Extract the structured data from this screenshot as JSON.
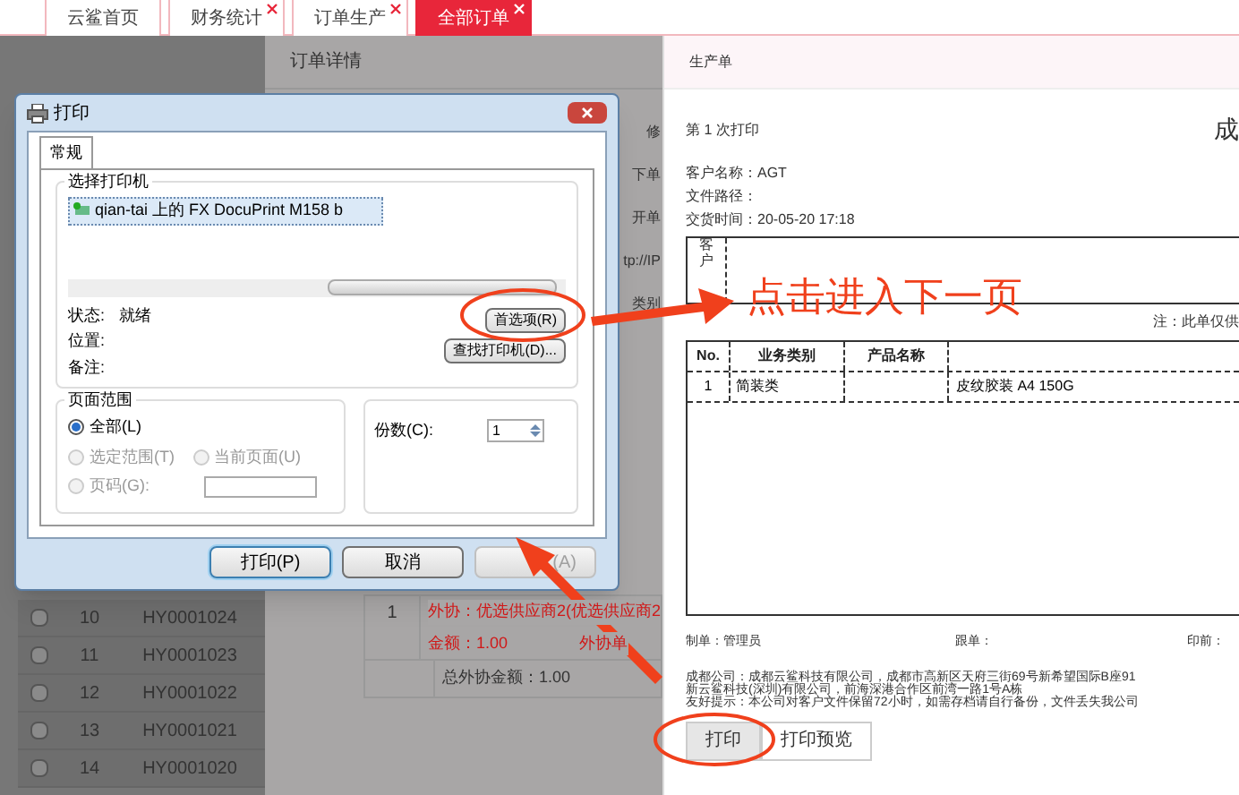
{
  "tabs": [
    {
      "label": "云鲨首页",
      "selected": false,
      "closable": false
    },
    {
      "label": "财务统计",
      "selected": false,
      "closable": true
    },
    {
      "label": "订单生产",
      "selected": false,
      "closable": true
    },
    {
      "label": "全部订单",
      "selected": true,
      "closable": true
    }
  ],
  "order_rows": [
    {
      "checked": false,
      "no": "10",
      "code": "HY0001024"
    },
    {
      "checked": false,
      "no": "11",
      "code": "HY0001023"
    },
    {
      "checked": false,
      "no": "12",
      "code": "HY0001022"
    },
    {
      "checked": false,
      "no": "13",
      "code": "HY0001021"
    },
    {
      "checked": false,
      "no": "14",
      "code": "HY0001020"
    }
  ],
  "order_detail": {
    "title": "订单详情",
    "fragments": [
      "修",
      "下单",
      "开单",
      "tp://IP",
      "类别"
    ],
    "table": {
      "row_no": "1",
      "outsource": "外协：优选供应商2(优选供应商2",
      "amount": "金额：1.00",
      "outsource_no": "外协单",
      "total": "总外协金额：1.00"
    }
  },
  "print_dialog": {
    "title": "打印",
    "tab": "常规",
    "printer_group": "选择打印机",
    "printer": "qian-tai 上的 FX DocuPrint M158 b",
    "status_label": "状态:",
    "status_value": "就绪",
    "location_label": "位置:",
    "comment_label": "备注:",
    "preferences_button": "首选项(R)",
    "find_printer_button": "查找打印机(D)...",
    "range_group": "页面范围",
    "range_options": [
      {
        "label": "全部(L)",
        "selected": true,
        "disabled": false
      },
      {
        "label": "选定范围(T)",
        "selected": false,
        "disabled": true
      },
      {
        "label": "当前页面(U)",
        "selected": false,
        "disabled": true
      },
      {
        "label": "页码(G):",
        "selected": false,
        "disabled": true
      }
    ],
    "copies_label": "份数(C):",
    "copies_value": "1",
    "buttons": [
      {
        "label": "打印(P)",
        "disabled": false,
        "default": true
      },
      {
        "label": "取消",
        "disabled": false,
        "default": false
      },
      {
        "label": "(A)",
        "disabled": true,
        "default": false
      }
    ]
  },
  "production_sheet": {
    "title": "生产单",
    "print_count": "第 1 次打印",
    "heading": "成",
    "fields": [
      "客户名称：AGT",
      "文件路径：",
      "交货时间：20-05-20 17:18"
    ],
    "requirement_label": "客户",
    "note": "注：此单仅供",
    "columns": [
      "No.",
      "业务类别",
      "产品名称"
    ],
    "rows": [
      {
        "no": "1",
        "category": "简装类",
        "spec": "皮纹胶装 A4 150G"
      }
    ],
    "signatures": [
      "制单：管理员",
      "跟单：",
      "印前："
    ],
    "company_lines": [
      "成都公司：成都云鲨科技有限公司，成都市高新区天府三街69号新希望国际B座91",
      "新云鲨科技(深圳)有限公司，前海深港合作区前湾一路1号A栋",
      "友好提示：本公司对客户文件保留72小时，如需存档请自行备份，文件丢失我公司"
    ],
    "buttons": [
      {
        "label": "打印",
        "highlighted": true
      },
      {
        "label": "打印预览",
        "highlighted": false
      }
    ]
  },
  "annotation": "点击进入下一页"
}
